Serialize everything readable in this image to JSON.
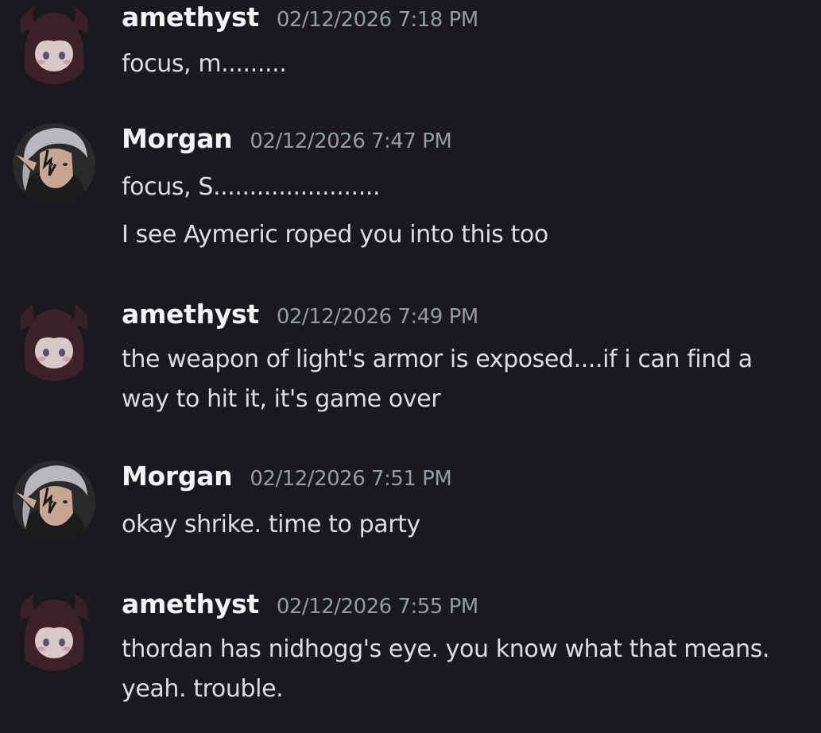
{
  "messages": [
    {
      "author": "amethyst",
      "timestamp": "02/12/2026 7:18 PM",
      "avatar_icon": "anime-girl-dark-hair-avatar-icon",
      "lines": [
        "focus, m........."
      ]
    },
    {
      "author": "Morgan",
      "timestamp": "02/12/2026 7:47 PM",
      "avatar_icon": "silver-hair-elf-avatar-icon",
      "lines": [
        "focus, S.......................",
        "I see Aymeric roped you into this too"
      ]
    },
    {
      "author": "amethyst",
      "timestamp": "02/12/2026 7:49 PM",
      "avatar_icon": "anime-girl-dark-hair-avatar-icon",
      "lines": [
        "the weapon of light's armor is exposed....if i can find a",
        "way to hit it, it's game over"
      ]
    },
    {
      "author": "Morgan",
      "timestamp": "02/12/2026 7:51 PM",
      "avatar_icon": "silver-hair-elf-avatar-icon",
      "lines": [
        "okay shrike. time to party"
      ]
    },
    {
      "author": "amethyst",
      "timestamp": "02/12/2026 7:55 PM",
      "avatar_icon": "anime-girl-dark-hair-avatar-icon",
      "lines": [
        "thordan has nidhogg's eye. you know what that means.",
        "yeah. trouble."
      ]
    }
  ],
  "colors": {
    "background": "#1a1a1e",
    "author": "#f2f3f5",
    "timestamp": "#949ba4",
    "text": "#dbdee1"
  }
}
